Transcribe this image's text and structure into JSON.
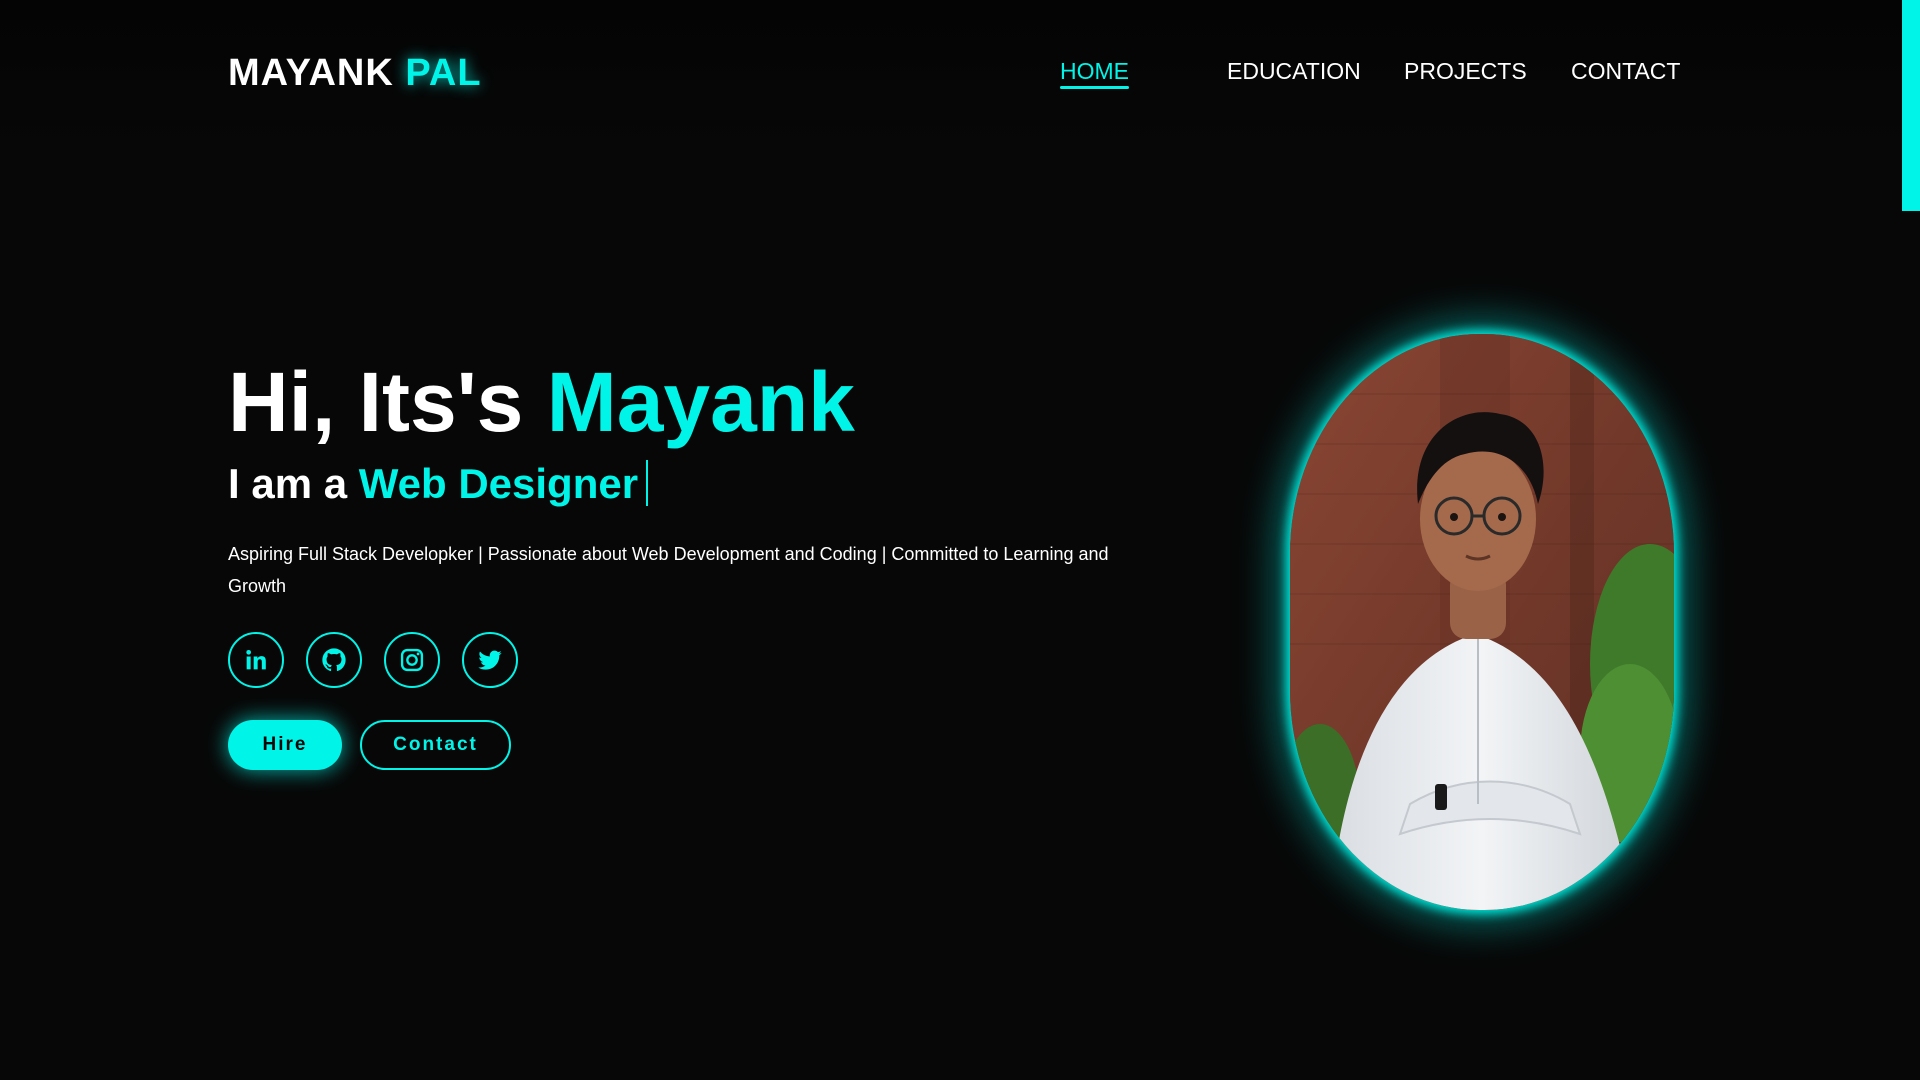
{
  "logo": {
    "first": "MAYANK",
    "accent": "PAL"
  },
  "nav": {
    "items": [
      {
        "label": "HOME",
        "active": true
      },
      {
        "label": "EDUCATION",
        "active": false
      },
      {
        "label": "PROJECTS",
        "active": false
      },
      {
        "label": "CONTACT",
        "active": false
      }
    ]
  },
  "hero": {
    "greeting": "Hi, Its's ",
    "name": "Mayank",
    "role_prefix": "I am a ",
    "role": "Web Designer",
    "tagline": "Aspiring Full Stack Developker | Passionate about Web Development and Coding | Committed to Learning and Growth"
  },
  "socials": [
    {
      "icon": "linkedin-icon"
    },
    {
      "icon": "github-icon"
    },
    {
      "icon": "instagram-icon"
    },
    {
      "icon": "twitter-icon"
    }
  ],
  "buttons": {
    "hire": "Hire",
    "contact": "Contact"
  },
  "colors": {
    "accent": "#00f5e8",
    "background": "#070707",
    "text": "#ffffff"
  }
}
